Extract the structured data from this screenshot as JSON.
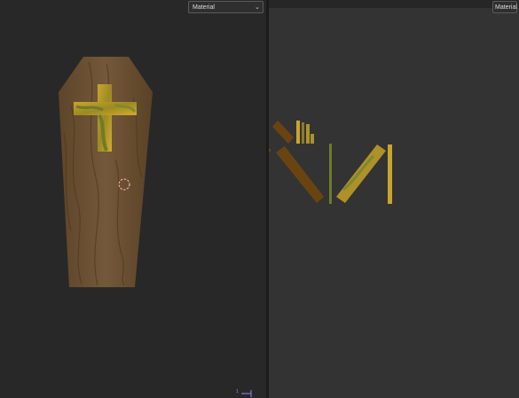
{
  "left_viewport": {
    "shading_dropdown": {
      "value": "Material",
      "icon": "chevron-down-icon"
    },
    "gizmo_axis_label": "1"
  },
  "right_viewport": {
    "shading_dropdown": {
      "value": "Material"
    }
  },
  "colors": {
    "wood": "#6e5232",
    "wood_dark": "#4f3a22",
    "gold": "#b0902a",
    "olive": "#6f7a2a",
    "uv_brown": "#6a4410"
  }
}
